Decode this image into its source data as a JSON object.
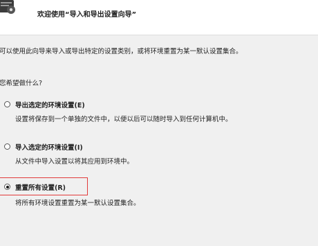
{
  "window": {
    "title": "欢迎使用“导入和导出设置向导”"
  },
  "intro_text": "可以使用此向导来导入或导出特定的设置类别，或将环境重置为某一默认设置集合。",
  "question_text": "您希望做什么?",
  "options": [
    {
      "label": "导出选定的环境设置(E)",
      "description": "设置将保存到一个单独的文件中，以便以后可以随时导入到任何计算机中。",
      "selected": false
    },
    {
      "label": "导入选定的环境设置(I)",
      "description": "从文件中导入设置以将其应用到环境中。",
      "selected": false
    },
    {
      "label": "重置所有设置(R)",
      "description": "将所有环境设置重置为某一默认设置集合。",
      "selected": true
    }
  ],
  "icons": {
    "wizard": "wizard-icon"
  },
  "colors": {
    "highlight": "#e23a3a",
    "header_bg": "#ffffff",
    "body_bg": "#f0f0f0"
  }
}
